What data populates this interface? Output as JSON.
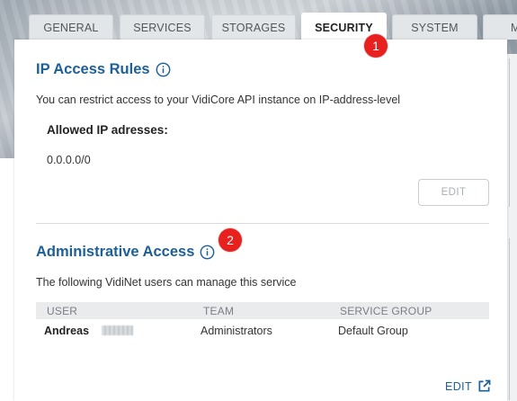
{
  "tabs": [
    {
      "label": "GENERAL"
    },
    {
      "label": "SERVICES"
    },
    {
      "label": "STORAGES"
    },
    {
      "label": "SECURITY"
    },
    {
      "label": "SYSTEM"
    },
    {
      "label": "M"
    }
  ],
  "active_tab": "SECURITY",
  "ip_rules": {
    "title": "IP Access Rules",
    "description": "You can restrict access to your VidiCore API instance on IP-address-level",
    "allowed_label": "Allowed IP adresses:",
    "allowed_value": "0.0.0.0/0",
    "edit_label": "EDIT"
  },
  "admin_access": {
    "title": "Administrative Access",
    "description": "The following VidiNet users can manage this service",
    "columns": [
      "USER",
      "TEAM",
      "SERVICE GROUP"
    ],
    "rows": [
      {
        "user": "Andreas",
        "team": "Administrators",
        "service_group": "Default Group"
      }
    ],
    "edit_label": "EDIT"
  },
  "callouts": [
    "1",
    "2"
  ],
  "colors": {
    "accent": "#1d5f97",
    "badge": "#e8211f"
  },
  "icons": {
    "info": "info-icon",
    "external_link": "external-link-icon"
  }
}
